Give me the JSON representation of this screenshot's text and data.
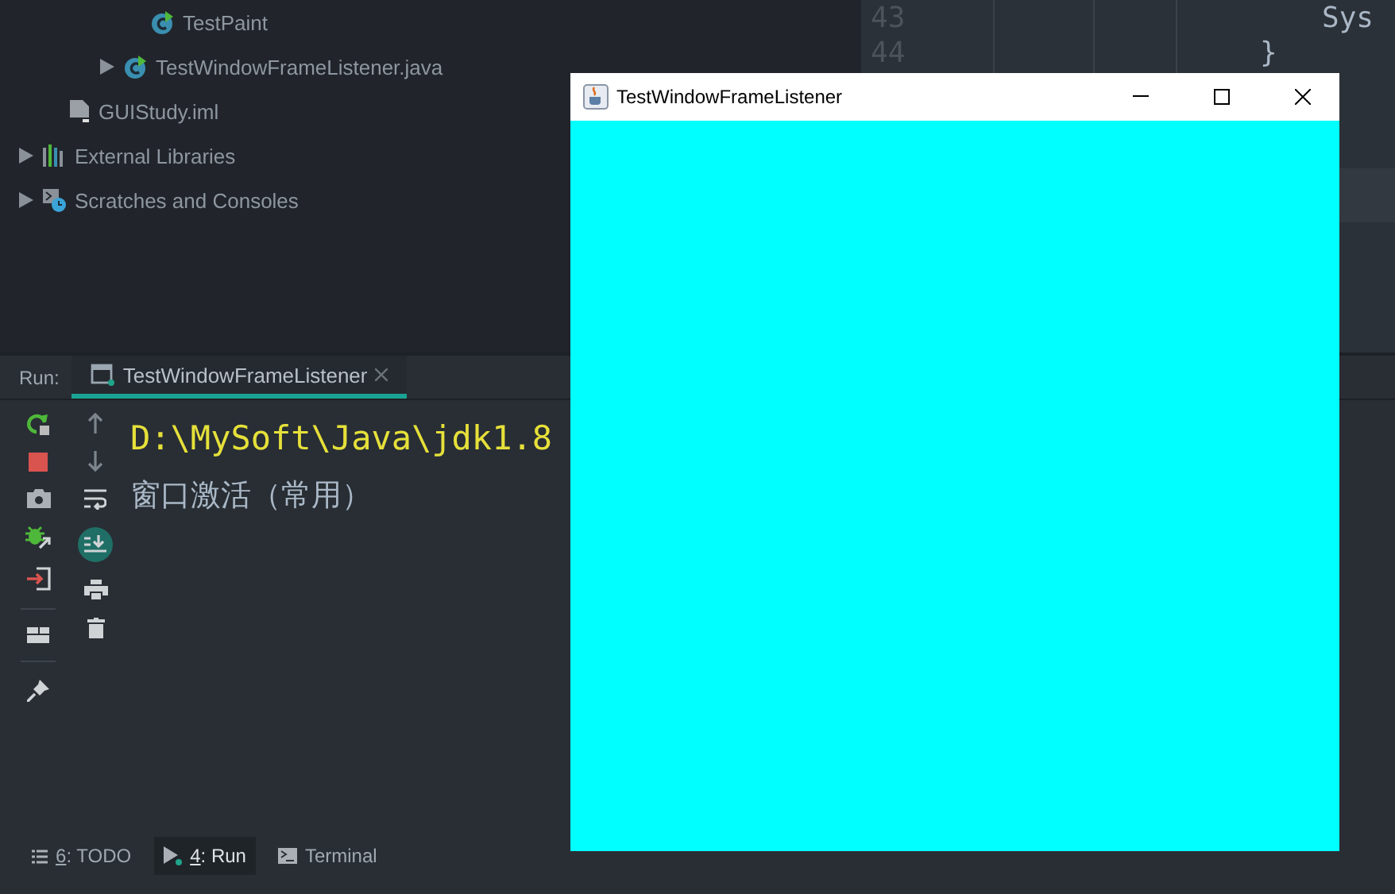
{
  "project_tree": [
    {
      "children": [
        {
          "children": [
            {
              "children": [
                {
                  "children": [
                    {
                      "label": "TestPaint",
                      "kind": "class"
                    }
                  ]
                },
                {
                  "label": "TestWindowFrameListener.java",
                  "kind": "class",
                  "expanded": false
                }
              ]
            }
          ]
        },
        {
          "label": "GUIStudy.iml",
          "kind": "iml"
        }
      ]
    },
    {
      "label": "External Libraries",
      "kind": "library",
      "expanded": false
    },
    {
      "label": "Scratches and Consoles",
      "kind": "scratches",
      "expanded": false
    }
  ],
  "editor": {
    "lines": [
      {
        "number": "43",
        "code": "Sys"
      },
      {
        "number": "44",
        "code": "}"
      }
    ]
  },
  "java_window": {
    "title": "TestWindowFrameListener"
  },
  "run_panel": {
    "label": "Run:",
    "tabs": [
      {
        "label": "TestWindowFrameListener",
        "selected": true
      }
    ],
    "scroll_to_end": {
      "on": true
    },
    "console": [
      {
        "kind": "command",
        "text": "D:\\MySoft\\Java\\jdk1.8"
      },
      {
        "kind": "output",
        "text": "窗口激活（常用）"
      }
    ]
  },
  "bottom_bar": [
    {
      "kind": "todo",
      "mnemonic": "6",
      "label": ": TODO",
      "selected": false
    },
    {
      "kind": "run",
      "mnemonic": "4",
      "label": ": Run",
      "selected": true
    },
    {
      "kind": "terminal",
      "label": "Terminal",
      "selected": false
    }
  ]
}
